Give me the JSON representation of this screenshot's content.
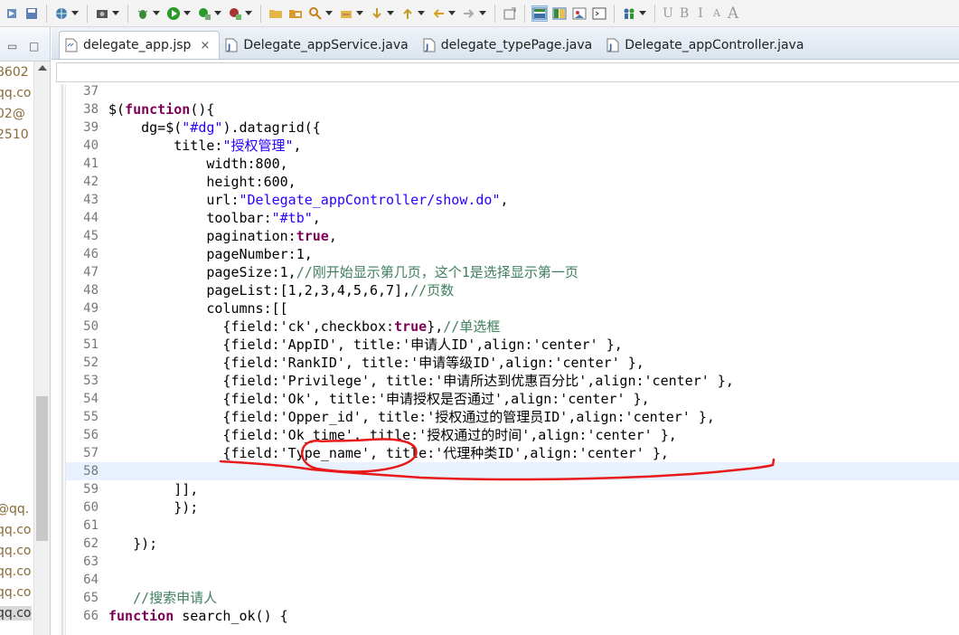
{
  "tabs": [
    {
      "label": "delegate_app.jsp",
      "close": "×",
      "active": true
    },
    {
      "label": "Delegate_appService.java",
      "active": false
    },
    {
      "label": "delegate_typePage.java",
      "active": false
    },
    {
      "label": "Delegate_appController.java",
      "active": false
    }
  ],
  "left_panel": {
    "rows": [
      "8602",
      "qq.co",
      "02@",
      "2510",
      "@qq.",
      "qq.co",
      "qq.co",
      "qq.co",
      "qq.co",
      "qq.co"
    ]
  },
  "toolbar": {
    "icons": [
      "skip-icon",
      "save-icon",
      "globe-icon",
      "camera-icon",
      "debug-icon",
      "run-icon",
      "run-server-icon",
      "external-tools-icon",
      "open-folder-icon",
      "open-type-icon",
      "search-icon",
      "open-task-icon",
      "next-annotation-icon",
      "prev-annotation-icon",
      "back-icon",
      "forward-icon",
      "new-window-icon",
      "layout-horizontal-icon",
      "layout-vertical-icon",
      "image-icon",
      "terminal-icon",
      "people-icon"
    ],
    "font_buttons": [
      "U",
      "B",
      "I",
      "A",
      "A"
    ]
  },
  "code": {
    "lines": [
      {
        "n": "37",
        "segs": [
          {
            "t": "",
            "c": ""
          }
        ]
      },
      {
        "n": "38",
        "segs": [
          {
            "t": "$(",
            "c": ""
          },
          {
            "t": "function",
            "c": "kw"
          },
          {
            "t": "(){",
            "c": ""
          }
        ]
      },
      {
        "n": "39",
        "segs": [
          {
            "t": "    dg=$(",
            "c": ""
          },
          {
            "t": "\"#dg\"",
            "c": "st"
          },
          {
            "t": ").datagrid({",
            "c": ""
          }
        ]
      },
      {
        "n": "40",
        "segs": [
          {
            "t": "        title:",
            "c": ""
          },
          {
            "t": "\"授权管理\"",
            "c": "st"
          },
          {
            "t": ",",
            "c": ""
          }
        ]
      },
      {
        "n": "41",
        "segs": [
          {
            "t": "            width:800,",
            "c": ""
          }
        ]
      },
      {
        "n": "42",
        "segs": [
          {
            "t": "            height:600,",
            "c": ""
          }
        ]
      },
      {
        "n": "43",
        "segs": [
          {
            "t": "            url:",
            "c": ""
          },
          {
            "t": "\"Delegate_appController/show.do\"",
            "c": "st"
          },
          {
            "t": ",",
            "c": ""
          }
        ]
      },
      {
        "n": "44",
        "segs": [
          {
            "t": "            toolbar:",
            "c": ""
          },
          {
            "t": "\"#tb\"",
            "c": "st"
          },
          {
            "t": ",",
            "c": ""
          }
        ]
      },
      {
        "n": "45",
        "segs": [
          {
            "t": "            pagination:",
            "c": ""
          },
          {
            "t": "true",
            "c": "kw"
          },
          {
            "t": ",",
            "c": ""
          }
        ]
      },
      {
        "n": "46",
        "segs": [
          {
            "t": "            pageNumber:1,",
            "c": ""
          }
        ]
      },
      {
        "n": "47",
        "segs": [
          {
            "t": "            pageSize:1,",
            "c": ""
          },
          {
            "t": "//刚开始显示第几页，这个1是选择显示第一页",
            "c": "cm"
          }
        ]
      },
      {
        "n": "48",
        "segs": [
          {
            "t": "            pageList:[1,2,3,4,5,6,7],",
            "c": ""
          },
          {
            "t": "//页数",
            "c": "cm"
          }
        ]
      },
      {
        "n": "49",
        "segs": [
          {
            "t": "            columns:[[",
            "c": ""
          }
        ]
      },
      {
        "n": "50",
        "segs": [
          {
            "t": "              {field:'ck',checkbox:",
            "c": ""
          },
          {
            "t": "true",
            "c": "kw"
          },
          {
            "t": "},",
            "c": ""
          },
          {
            "t": "//单选框",
            "c": "cm"
          }
        ]
      },
      {
        "n": "51",
        "segs": [
          {
            "t": "              {field:'AppID', title:'申请人ID',align:'center' },",
            "c": ""
          }
        ]
      },
      {
        "n": "52",
        "segs": [
          {
            "t": "              {field:'RankID', title:'申请等级ID',align:'center' },",
            "c": ""
          }
        ]
      },
      {
        "n": "53",
        "segs": [
          {
            "t": "              {field:'Privilege', title:'申请所达到优惠百分比',align:'center' },",
            "c": ""
          }
        ]
      },
      {
        "n": "54",
        "segs": [
          {
            "t": "              {field:'Ok', title:'申请授权是否通过',align:'center' },",
            "c": ""
          }
        ]
      },
      {
        "n": "55",
        "segs": [
          {
            "t": "              {field:'Opper_id', title:'授权通过的管理员ID',align:'center' },",
            "c": ""
          }
        ]
      },
      {
        "n": "56",
        "segs": [
          {
            "t": "              {field:'Ok_time', title:'授权通过的时间',align:'center' },",
            "c": ""
          }
        ]
      },
      {
        "n": "57",
        "segs": [
          {
            "t": "              {field:'Type_name', title:'代理种类ID',align:'center' },",
            "c": ""
          }
        ]
      },
      {
        "n": "58",
        "segs": [
          {
            "t": "",
            "c": ""
          }
        ],
        "current": true
      },
      {
        "n": "59",
        "segs": [
          {
            "t": "        ]],",
            "c": ""
          }
        ]
      },
      {
        "n": "60",
        "segs": [
          {
            "t": "        });",
            "c": ""
          }
        ]
      },
      {
        "n": "61",
        "segs": [
          {
            "t": "",
            "c": ""
          }
        ]
      },
      {
        "n": "62",
        "segs": [
          {
            "t": "   });",
            "c": ""
          }
        ]
      },
      {
        "n": "63",
        "segs": [
          {
            "t": "",
            "c": ""
          }
        ]
      },
      {
        "n": "64",
        "segs": [
          {
            "t": "",
            "c": ""
          }
        ]
      },
      {
        "n": "65",
        "segs": [
          {
            "t": "   ",
            "c": ""
          },
          {
            "t": "//搜索申请人",
            "c": "cm"
          }
        ]
      },
      {
        "n": "66",
        "segs": [
          {
            "t": "function",
            "c": "kw"
          },
          {
            "t": " search_ok() {",
            "c": ""
          }
        ]
      }
    ]
  },
  "colors": {
    "keyword": "#7f0055",
    "string": "#2a00ff",
    "comment": "#3f7f5f",
    "annotation": "#e8191b",
    "current_line": "#e8f2fe"
  }
}
